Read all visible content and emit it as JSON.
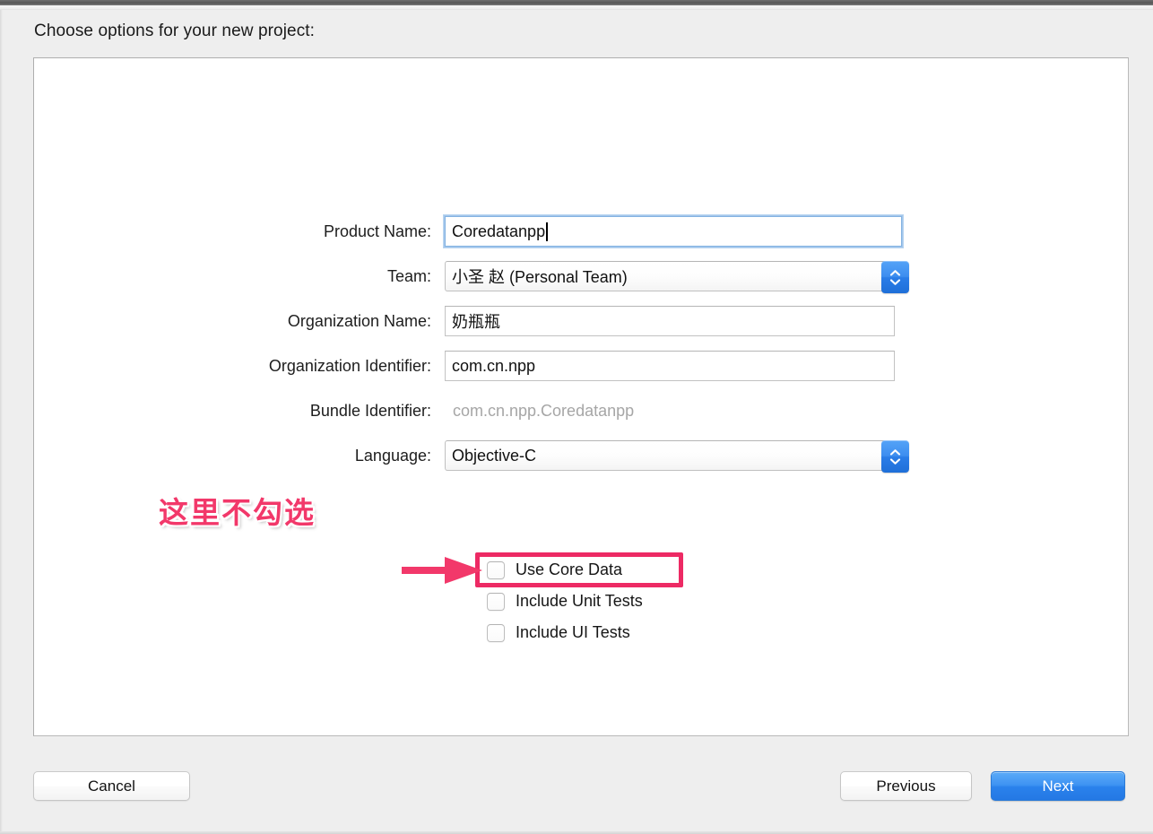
{
  "sheet": {
    "heading": "Choose options for your new project:"
  },
  "form": {
    "rows": [
      {
        "label": "Product Name:",
        "value": "Coredatanpp",
        "kind": "text-focused"
      },
      {
        "label": "Team:",
        "value": "小圣 赵 (Personal Team)",
        "kind": "popup"
      },
      {
        "label": "Organization Name:",
        "value": "奶瓶瓶",
        "kind": "text"
      },
      {
        "label": "Organization Identifier:",
        "value": "com.cn.npp",
        "kind": "text"
      },
      {
        "label": "Bundle Identifier:",
        "value": "com.cn.npp.Coredatanpp",
        "kind": "static"
      },
      {
        "label": "Language:",
        "value": "Objective-C",
        "kind": "popup"
      }
    ]
  },
  "checkboxes": [
    {
      "label": "Use Core Data",
      "checked": false
    },
    {
      "label": "Include Unit Tests",
      "checked": false
    },
    {
      "label": "Include UI Tests",
      "checked": false
    }
  ],
  "annotation": {
    "text": "这里不勾选",
    "color": "#F2386A",
    "highlight_color": "#ED2A64",
    "target": "Use Core Data"
  },
  "footer": {
    "cancel": "Cancel",
    "previous": "Previous",
    "next": "Next"
  },
  "colors": {
    "accent_blue": "#2a82ec",
    "focus_ring": "#7eb0e4",
    "window_bg": "#eeeeee",
    "panel_bg": "#ffffff",
    "static_text": "#a6a6a6"
  }
}
